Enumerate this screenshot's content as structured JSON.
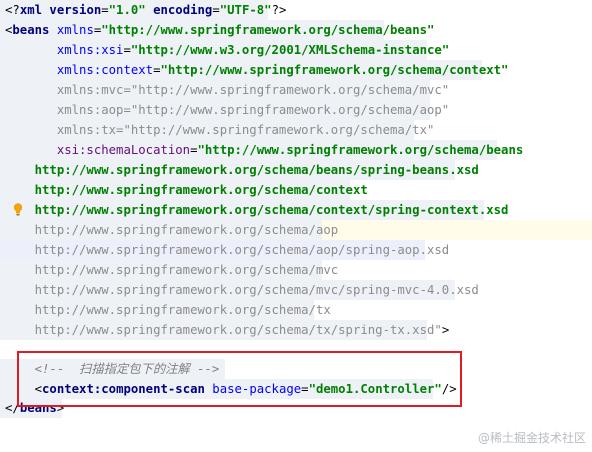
{
  "editor": {
    "lines": [
      {
        "parts": [
          [
            "<?",
            "punct"
          ],
          [
            "xml version",
            "tag"
          ],
          [
            "=",
            "punct"
          ],
          [
            "\"1.0\"",
            "val"
          ],
          [
            " encoding",
            "tag"
          ],
          [
            "=",
            "punct"
          ],
          [
            "\"UTF-8\"",
            "val"
          ],
          [
            "?>",
            "punct"
          ]
        ]
      },
      {
        "parts": [
          [
            "<",
            "punct"
          ],
          [
            "beans",
            "tag"
          ],
          [
            " xmlns",
            "attr"
          ],
          [
            "=",
            "punct"
          ],
          [
            "\"http://www.springframework.org/schema/beans\"",
            "val"
          ]
        ]
      },
      {
        "parts": [
          [
            "       xmlns:xsi",
            "attr"
          ],
          [
            "=",
            "punct"
          ],
          [
            "\"http://www.w3.org/2001/XMLSchema-instance\"",
            "val"
          ]
        ]
      },
      {
        "parts": [
          [
            "       xmlns:context",
            "attr"
          ],
          [
            "=",
            "punct"
          ],
          [
            "\"http://www.springframework.org/schema/context\"",
            "val"
          ]
        ]
      },
      {
        "parts": [
          [
            "       xmlns:mvc=\"http://www.springframework.org/schema/mvc\"",
            "grey"
          ]
        ]
      },
      {
        "parts": [
          [
            "       xmlns:aop=\"http://www.springframework.org/schema/aop\"",
            "grey"
          ]
        ]
      },
      {
        "parts": [
          [
            "       xmlns:tx=\"http://www.springframework.org/schema/tx\"",
            "grey"
          ]
        ]
      },
      {
        "parts": [
          [
            "       xsi:schemaLocation",
            "prefix"
          ],
          [
            "=",
            "punct"
          ],
          [
            "\"http://www.springframework.org/schema/beans",
            "val"
          ]
        ]
      },
      {
        "parts": [
          [
            "    http://www.springframework.org/schema/beans/spring-beans.xsd",
            "val"
          ]
        ]
      },
      {
        "parts": [
          [
            "    http://www.springframework.org/schema/context",
            "val"
          ]
        ]
      },
      {
        "parts": [
          [
            "    http://www.springframework.org/schema/context/spring-context.xsd",
            "val"
          ]
        ]
      },
      {
        "parts": [
          [
            "    http://www.springframework.org/schema/aop",
            "grey"
          ]
        ]
      },
      {
        "parts": [
          [
            "    http://www.springframework.org/schema/aop/spring-aop.xsd",
            "grey"
          ]
        ]
      },
      {
        "parts": [
          [
            "    http://www.springframework.org/schema/mvc",
            "grey"
          ]
        ]
      },
      {
        "parts": [
          [
            "    http://www.springframework.org/schema/mvc/spring-mvc-4.0.xsd",
            "grey"
          ]
        ]
      },
      {
        "parts": [
          [
            "    http://www.springframework.org/schema/tx",
            "grey"
          ]
        ]
      },
      {
        "parts": [
          [
            "    http://www.springframework.org/schema/tx/spring-tx.xsd\"",
            "grey"
          ],
          [
            ">",
            "punct"
          ]
        ]
      },
      {
        "parts": []
      },
      {
        "parts": [
          [
            "    <!--  扫描指定包下的注解 -->",
            "comment"
          ]
        ]
      },
      {
        "parts": [
          [
            "    <",
            "punct"
          ],
          [
            "context:component-scan",
            "tag"
          ],
          [
            " base-package",
            "attr"
          ],
          [
            "=",
            "punct"
          ],
          [
            "\"demo1.Controller\"",
            "val"
          ],
          [
            "/>",
            "punct"
          ]
        ]
      },
      {
        "parts": [
          [
            "</",
            "punct"
          ],
          [
            "beans",
            "tag"
          ],
          [
            ">",
            "punct"
          ]
        ]
      }
    ]
  },
  "watermark": "@稀土掘金技术社区"
}
